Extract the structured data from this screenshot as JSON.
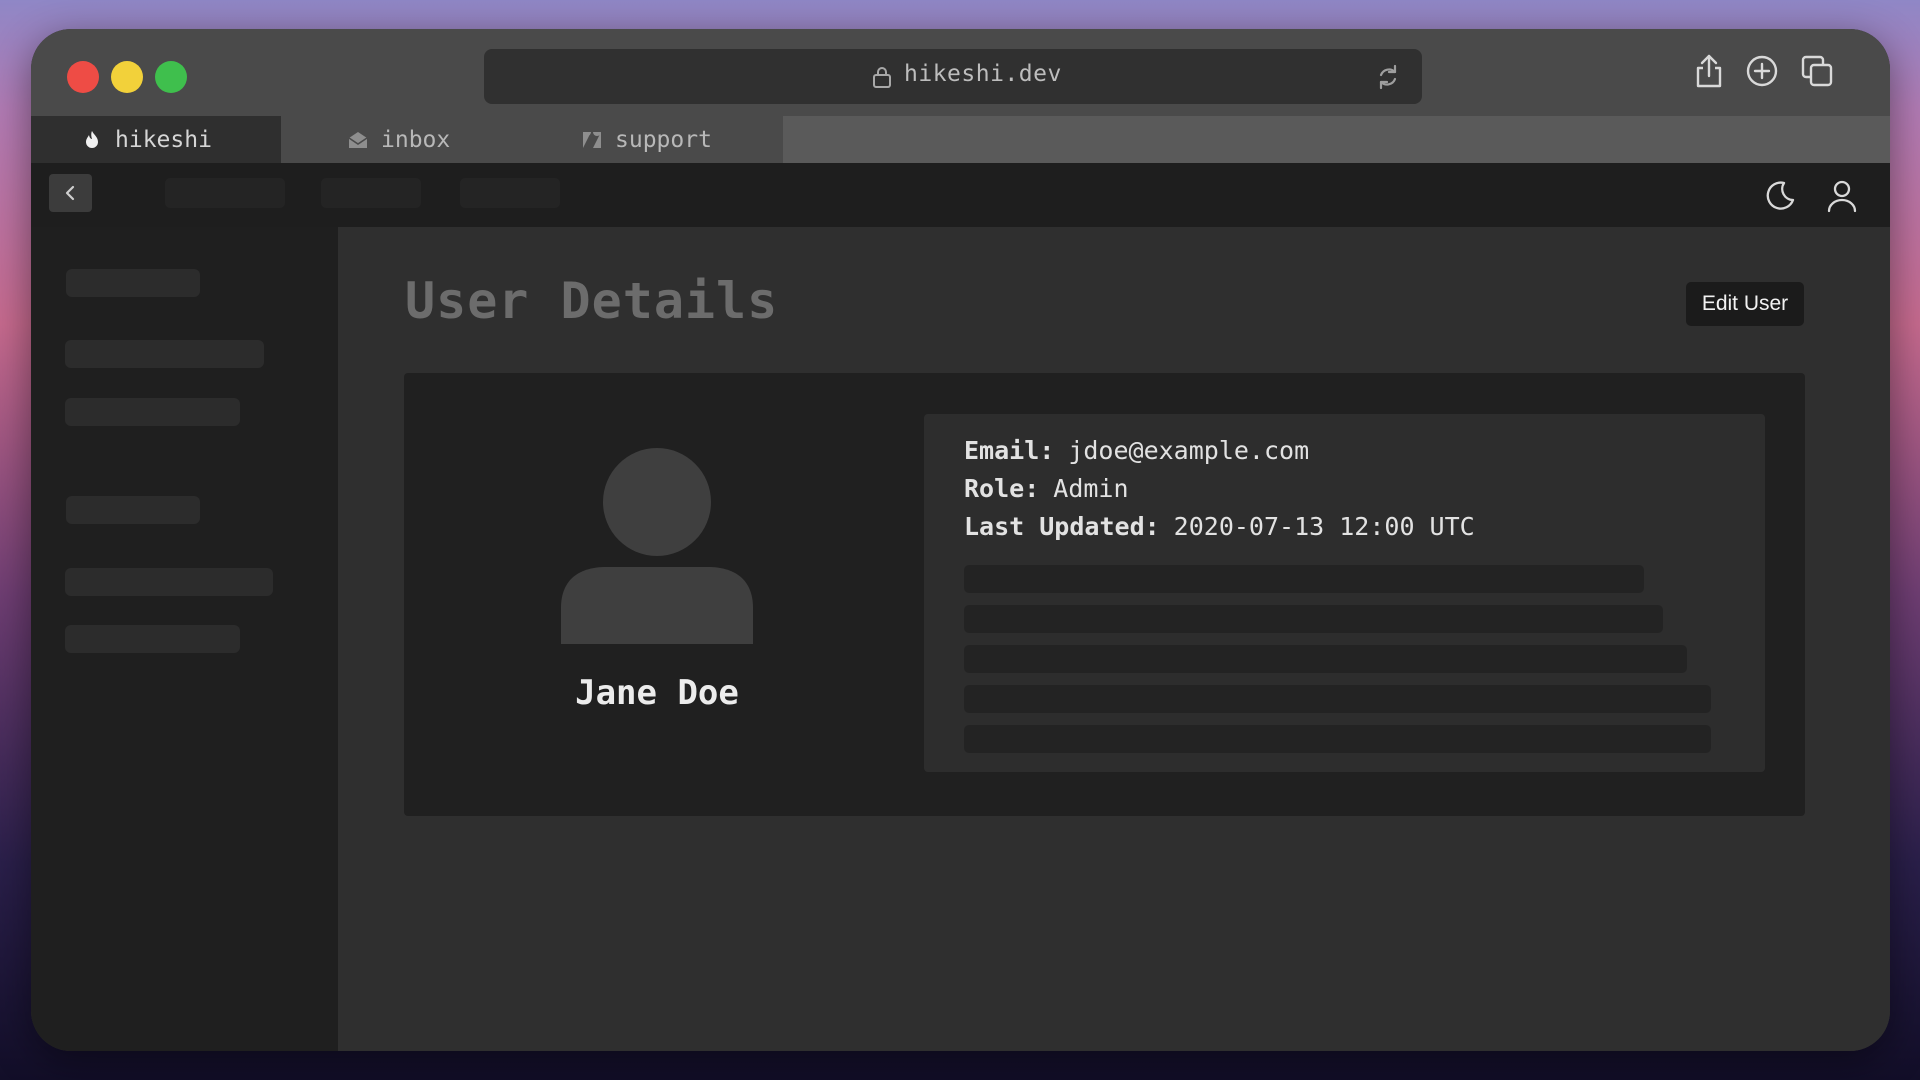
{
  "browser": {
    "url": "hikeshi.dev",
    "tabs": [
      {
        "label": "hikeshi",
        "icon": "flame-icon",
        "active": true
      },
      {
        "label": "inbox",
        "icon": "mail-icon",
        "active": false
      },
      {
        "label": "support",
        "icon": "zendesk-icon",
        "active": false
      }
    ],
    "toolbar_icons": [
      "share-icon",
      "new-tab-icon",
      "tabs-overview-icon"
    ]
  },
  "appbar": {
    "icons": [
      "back-icon",
      "moon-icon",
      "user-icon"
    ]
  },
  "main": {
    "title": "User Details",
    "edit_button": "Edit User"
  },
  "user": {
    "name": "Jane Doe",
    "email_label": "Email:",
    "email": "jdoe@example.com",
    "role_label": "Role:",
    "role": "Admin",
    "updated_label": "Last Updated:",
    "updated": "2020-07-13 12:00 UTC"
  },
  "colors": {
    "close": "#ee4c45",
    "minimize": "#f2d13a",
    "maximize": "#3fbf4d"
  }
}
